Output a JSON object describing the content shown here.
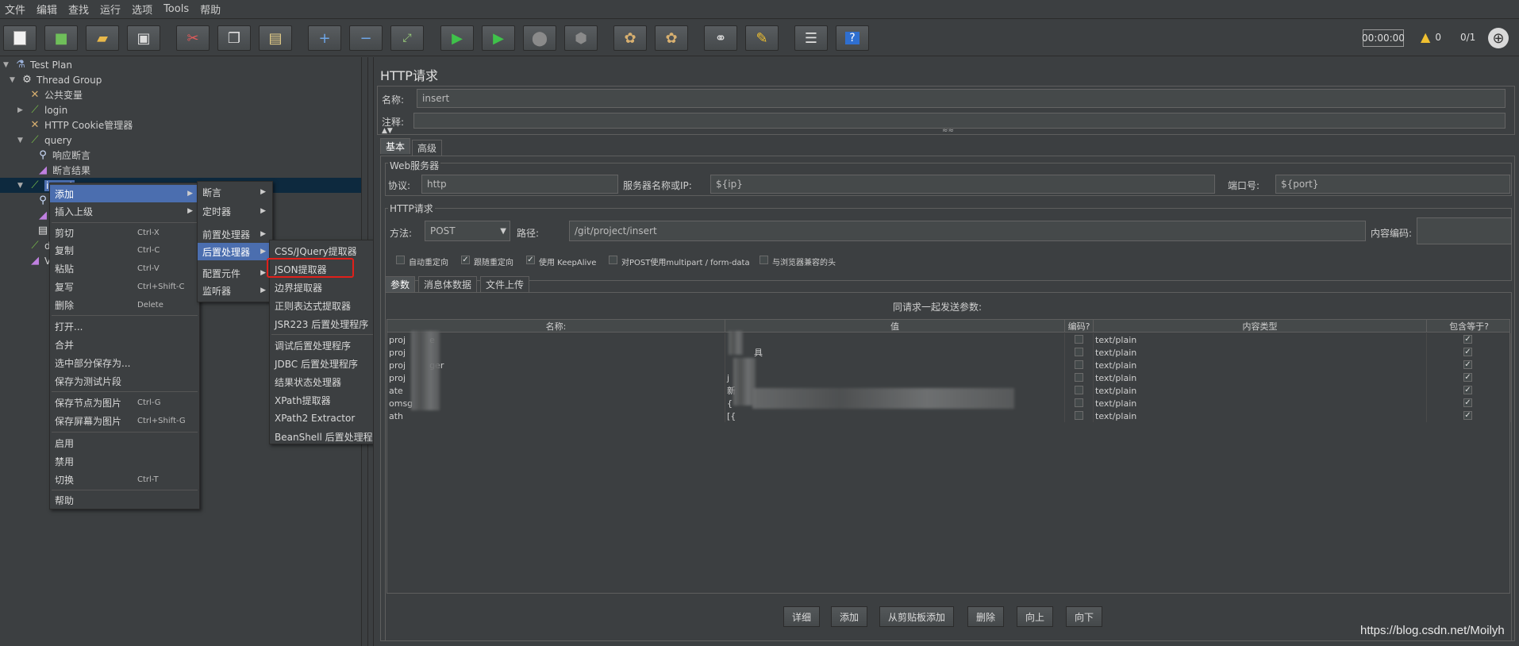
{
  "menubar": {
    "items": [
      "文件",
      "编辑",
      "查找",
      "运行",
      "选项",
      "Tools",
      "帮助"
    ]
  },
  "toolbar": {
    "timer": "00:00:00",
    "warning_count": "0",
    "threads": "0/1",
    "icons": [
      "new-icon",
      "templates-icon",
      "open-icon",
      "save-icon",
      "cut-icon",
      "copy-icon",
      "paste-icon",
      "expand-icon",
      "collapse-icon",
      "toggle-icon",
      "start-icon",
      "start-no-pause-icon",
      "stop-icon",
      "shutdown-icon",
      "clear-icon",
      "clear-all-icon",
      "search-icon",
      "reset-search-icon",
      "function-helper-icon",
      "help-icon"
    ]
  },
  "tree": {
    "items": [
      {
        "label": "Test Plan",
        "icon": "flask-icon"
      },
      {
        "label": "Thread Group",
        "icon": "gear-icon"
      },
      {
        "label": "公共变量",
        "icon": "wrench-icon"
      },
      {
        "label": "login",
        "icon": "pipette-icon"
      },
      {
        "label": "HTTP Cookie管理器",
        "icon": "wrench-icon"
      },
      {
        "label": "query",
        "icon": "pipette-icon"
      },
      {
        "label": "响应断言",
        "icon": "magnifier-icon"
      },
      {
        "label": "断言结果",
        "icon": "graph-icon"
      },
      {
        "label": "insert",
        "icon": "pipette-icon"
      },
      {
        "label": "",
        "icon": "magnifier-icon"
      },
      {
        "label": "",
        "icon": "graph-icon"
      },
      {
        "label": "",
        "icon": "document-icon"
      },
      {
        "label": "d",
        "icon": "pipette-icon"
      },
      {
        "label": "V",
        "icon": "graph-icon"
      }
    ]
  },
  "context_menu": {
    "items": [
      {
        "label": "添加",
        "shortcut": "",
        "submenu": true
      },
      {
        "label": "插入上级",
        "shortcut": "",
        "submenu": true
      },
      {
        "label": "剪切",
        "shortcut": "Ctrl-X"
      },
      {
        "label": "复制",
        "shortcut": "Ctrl-C"
      },
      {
        "label": "粘贴",
        "shortcut": "Ctrl-V"
      },
      {
        "label": "复写",
        "shortcut": "Ctrl+Shift-C"
      },
      {
        "label": "删除",
        "shortcut": "Delete"
      },
      {
        "label": "打开...",
        "shortcut": ""
      },
      {
        "label": "合并",
        "shortcut": ""
      },
      {
        "label": "选中部分保存为...",
        "shortcut": ""
      },
      {
        "label": "保存为测试片段",
        "shortcut": ""
      },
      {
        "label": "保存节点为图片",
        "shortcut": "Ctrl-G"
      },
      {
        "label": "保存屏幕为图片",
        "shortcut": "Ctrl+Shift-G"
      },
      {
        "label": "启用",
        "shortcut": ""
      },
      {
        "label": "禁用",
        "shortcut": ""
      },
      {
        "label": "切换",
        "shortcut": "Ctrl-T"
      },
      {
        "label": "帮助",
        "shortcut": ""
      }
    ]
  },
  "add_menu": {
    "items": [
      "断言",
      "定时器",
      "前置处理器",
      "后置处理器",
      "配置元件",
      "监听器"
    ]
  },
  "post_processor_menu": {
    "items": [
      "CSS/JQuery提取器",
      "JSON提取器",
      "边界提取器",
      "正则表达式提取器",
      "JSR223 后置处理程序",
      "调试后置处理程序",
      "JDBC 后置处理程序",
      "结果状态处理器",
      "XPath提取器",
      "XPath2 Extractor",
      "BeanShell 后置处理程序"
    ]
  },
  "http_request": {
    "title": "HTTP请求",
    "name_label": "名称:",
    "name_value": "insert",
    "comment_label": "注释:",
    "tabs": [
      "基本",
      "高级"
    ],
    "web_server_label": "Web服务器",
    "protocol_label": "协议:",
    "protocol_value": "http",
    "server_label": "服务器名称或IP:",
    "server_value": "${ip}",
    "port_label": "端口号:",
    "port_value": "${port}",
    "http_req_label": "HTTP请求",
    "method_label": "方法:",
    "method_value": "POST",
    "path_label": "路径:",
    "path_value": "/git/project/insert",
    "encoding_label": "内容编码:",
    "options": [
      {
        "label": "自动重定向",
        "checked": false
      },
      {
        "label": "跟随重定向",
        "checked": true
      },
      {
        "label": "使用 KeepAlive",
        "checked": true
      },
      {
        "label": "对POST使用multipart / form-data",
        "checked": false
      },
      {
        "label": "与浏览器兼容的头",
        "checked": false
      }
    ],
    "sub_tabs": [
      "参数",
      "消息体数据",
      "文件上传"
    ],
    "table_title": "同请求一起发送参数:",
    "columns": [
      "名称:",
      "值",
      "编码?",
      "内容类型",
      "包含等于?"
    ],
    "rows": [
      {
        "name": "proj",
        "name_tail": "e",
        "value": "",
        "value_tail": "",
        "type": "text/plain"
      },
      {
        "name": "proj",
        "name_tail": "",
        "value": "",
        "value_tail": "具",
        "type": "text/plain"
      },
      {
        "name": "proj",
        "name_tail": "ger",
        "value": "",
        "value_tail": "",
        "type": "text/plain"
      },
      {
        "name": "proj",
        "name_tail": "",
        "value": "j",
        "value_tail": "",
        "type": "text/plain"
      },
      {
        "name": "ate",
        "name_tail": "",
        "value": "新",
        "value_tail": "",
        "type": "text/plain"
      },
      {
        "name": "omsg",
        "name_tail": "",
        "value": "{",
        "value_tail": "",
        "type": "text/plain"
      },
      {
        "name": "ath",
        "name_tail": "",
        "value": "[{",
        "value_tail": "",
        "type": "text/plain"
      }
    ],
    "buttons": [
      "详细",
      "添加",
      "从剪贴板添加",
      "删除",
      "向上",
      "向下"
    ]
  },
  "watermark": "https://blog.csdn.net/Moilyh",
  "colors": {
    "background": "#3c3f41",
    "selection": "#4b6eaf",
    "highlight_box": "#e0201a"
  }
}
